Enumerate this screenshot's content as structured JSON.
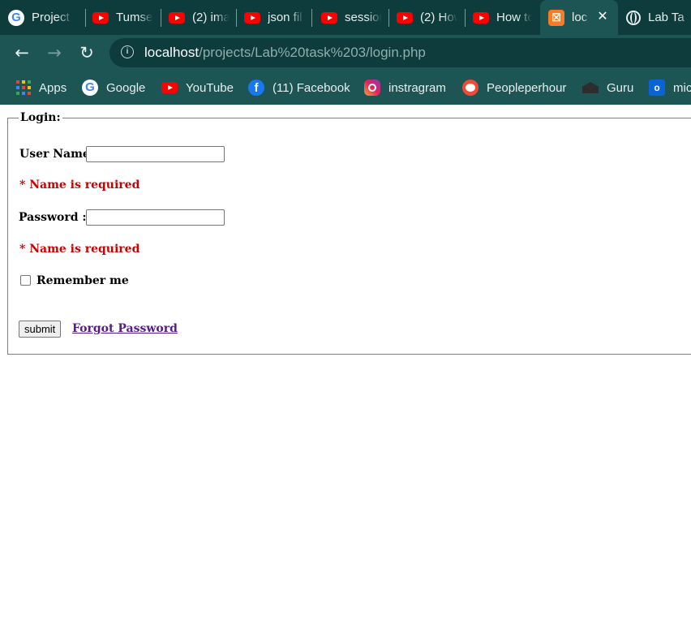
{
  "browser": {
    "tabs": [
      {
        "title": "Project",
        "icon": "google-icon"
      },
      {
        "title": "Tumse",
        "icon": "youtube-icon"
      },
      {
        "title": "(2) ima",
        "icon": "youtube-icon"
      },
      {
        "title": "json fil",
        "icon": "youtube-icon"
      },
      {
        "title": "session",
        "icon": "youtube-icon"
      },
      {
        "title": "(2) How",
        "icon": "youtube-icon"
      },
      {
        "title": "How to",
        "icon": "youtube-icon"
      },
      {
        "title": "loc",
        "icon": "xampp-icon",
        "active": true,
        "close_glyph": "✕"
      },
      {
        "title": "Lab Ta",
        "icon": "globe-icon"
      }
    ],
    "nav": {
      "back": "←",
      "forward": "→",
      "reload": "↻"
    },
    "url": {
      "info_glyph": "i",
      "host": "localhost",
      "path": "/projects/Lab%20task%203/login.php"
    },
    "bookmarks": [
      {
        "label": "Apps",
        "icon": "apps-grid-icon"
      },
      {
        "label": "Google",
        "icon": "google-icon"
      },
      {
        "label": "YouTube",
        "icon": "youtube-icon"
      },
      {
        "label": "(11) Facebook",
        "icon": "facebook-icon"
      },
      {
        "label": "instragram",
        "icon": "instagram-icon"
      },
      {
        "label": "Peopleperhour",
        "icon": "peopleperhour-icon"
      },
      {
        "label": "Guru",
        "icon": "guru-icon"
      },
      {
        "label": "mic",
        "icon": "outlook-icon"
      }
    ],
    "colors": {
      "chrome_dark": "#0e3b3b",
      "chrome_light": "#1d5554"
    }
  },
  "form": {
    "legend": "Login:",
    "username_label": "User Name:",
    "username_value": "",
    "username_error": "*  Name is required",
    "password_label": "Password :",
    "password_value": "",
    "password_error": "*  Name is required",
    "remember_label": "Remember me",
    "remember_checked": false,
    "submit_label": "submit",
    "forgot_link": "Forgot Password",
    "colors": {
      "error": "#cc0000",
      "link": "#551a8b"
    }
  }
}
